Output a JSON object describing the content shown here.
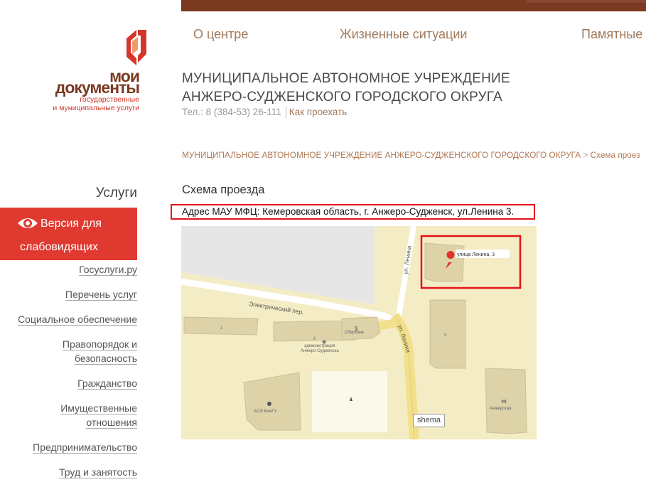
{
  "nav": {
    "items": [
      {
        "label": "О центре"
      },
      {
        "label": "Жизненные ситуации"
      },
      {
        "label": "Памятные"
      }
    ]
  },
  "logo": {
    "word1": "мои",
    "word2": "документы",
    "sub1": "государственные",
    "sub2": "и муниципальные услуги"
  },
  "header": {
    "org_title_line1": "МУНИЦИПАЛЬНОЕ АВТОНОМНОЕ УЧРЕЖДЕНИЕ",
    "org_title_line2": "АНЖЕРО-СУДЖЕНСКОГО ГОРОДСКОГО ОКРУГА",
    "phone": "Тел.: 8 (384-53) 26-111",
    "route_link": "Как проехать"
  },
  "breadcrumb": {
    "parent": "МУНИЦИПАЛЬНОЕ АВТОНОМНОЕ УЧРЕЖДЕНИЕ АНЖЕРО-СУДЖЕНСКОГО ГОРОДСКОГО ОКРУГА",
    "separator": ">",
    "current": "Схема проез"
  },
  "sidebar": {
    "heading": "Услуги",
    "vision_line1": "Версия для",
    "vision_line2": "слабовидящих",
    "links": [
      {
        "lines": [
          "Госуслуги.ру"
        ]
      },
      {
        "lines": [
          "Перечень услуг"
        ]
      },
      {
        "lines": [
          "Социальное обеспечение"
        ]
      },
      {
        "lines": [
          "Правопорядок и",
          "безопасность"
        ]
      },
      {
        "lines": [
          "Гражданство"
        ]
      },
      {
        "lines": [
          "Имущественные",
          "отношения"
        ]
      },
      {
        "lines": [
          "Предпринимательство"
        ]
      },
      {
        "lines": [
          "Труд и занятость"
        ]
      }
    ]
  },
  "main": {
    "title": "Схема проезда",
    "address": "Адрес МАУ МФЦ: Кемеровская область, г. Анжеро-Судженск, ул.Ленина 3."
  },
  "map": {
    "street_electric": "Электрический пер.",
    "street_lenina_top": "ул. Ленина",
    "street_lenina": "ул. Ленина",
    "marker_label": "улица Ленина, 3",
    "building_1": "1",
    "building_6": "6",
    "building_5": "5",
    "admin_line1": "администрация",
    "admin_line2": "Анжеро-Судженска",
    "bank": "Сбербанк",
    "asf": "АСФ КемГУ",
    "anzherskaya": "Анжерская",
    "schema_btn": "shema"
  },
  "colors": {
    "brand_brown": "#7a3a22",
    "nav_text": "#a0795b",
    "accent_red": "#e03a30",
    "highlight_red": "#e3131b",
    "map_bg": "#f4ecc4"
  }
}
